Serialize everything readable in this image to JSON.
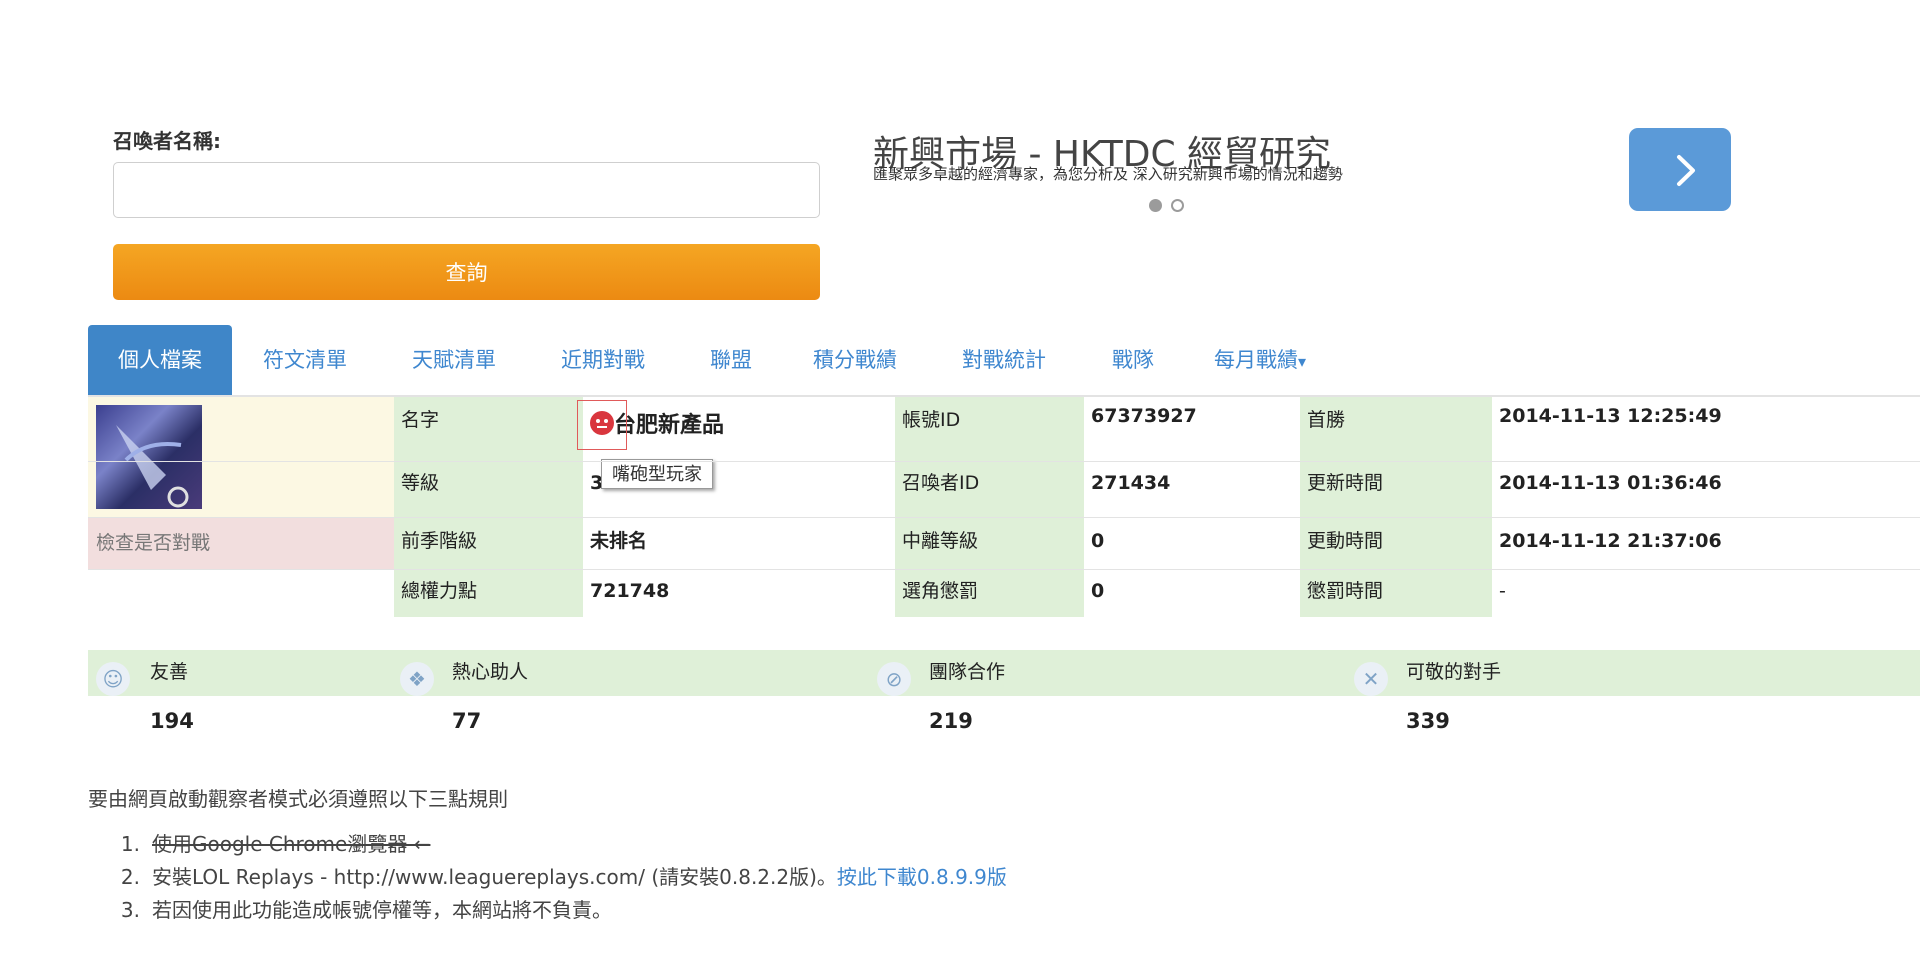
{
  "search": {
    "label": "召喚者名稱:",
    "input_value": "",
    "button_label": "查詢"
  },
  "ad": {
    "title": "新興市場 - HKTDC 經貿研究",
    "description": "匯聚眾多卓越的經濟專家，為您分析及 深入研究新興市場的情況和趨勢",
    "next_icon": "chevron-right-icon",
    "accent_color": "#5b9ad8"
  },
  "tabs": [
    {
      "label": "個人檔案",
      "active": true
    },
    {
      "label": "符文清單"
    },
    {
      "label": "天賦清單"
    },
    {
      "label": "近期對戰"
    },
    {
      "label": "聯盟"
    },
    {
      "label": "積分戰績"
    },
    {
      "label": "對戰統計"
    },
    {
      "label": "戰隊"
    },
    {
      "label": "每月戰績",
      "dropdown": true,
      "caret": "▾"
    }
  ],
  "profile": {
    "check_game": "檢查是否對戰",
    "name_label": "名字",
    "name_value": "台肥新產品",
    "name_badge_icon": "angry-face-icon",
    "tooltip": "嘴砲型玩家",
    "level_label": "等級",
    "level_value": "3",
    "prev_tier_label": "前季階級",
    "prev_tier_value": "未排名",
    "influence_label": "總權力點",
    "influence_value": "721748",
    "account_id_label": "帳號ID",
    "account_id_value": "67373927",
    "summoner_id_label": "召喚者ID",
    "summoner_id_value": "271434",
    "leaver_label": "中離等級",
    "leaver_value": "0",
    "dodge_label": "選角懲罰",
    "dodge_value": "0",
    "first_win_label": "首勝",
    "first_win_value": "2014-11-13 12:25:49",
    "updated_label": "更新時間",
    "updated_value": "2014-11-13 01:36:46",
    "modified_label": "更動時間",
    "modified_value": "2014-11-12 21:37:06",
    "penalty_label": "懲罰時間",
    "penalty_value": "-",
    "label_bg": "#dff0d8",
    "check_bg": "#f2dede"
  },
  "honors": [
    {
      "label": "友善",
      "count": "194",
      "icon": "smile-icon"
    },
    {
      "label": "熱心助人",
      "count": "77",
      "icon": "hands-icon"
    },
    {
      "label": "團隊合作",
      "count": "219",
      "icon": "team-icon"
    },
    {
      "label": "可敬的對手",
      "count": "339",
      "icon": "crossed-swords-icon"
    }
  ],
  "rules": {
    "intro": "要由網頁啟動觀察者模式必須遵照以下三點規則",
    "items": [
      {
        "num": "1.",
        "text": "使用Google Chrome瀏覽器 ←"
      },
      {
        "num": "2.",
        "text": "安裝LOL Replays - http://www.leaguereplays.com/ (請安裝0.8.2.2版)。",
        "link": "按此下載0.8.9.9版"
      },
      {
        "num": "3.",
        "text": "若因使用此功能造成帳號停權等，本網站將不負責。"
      }
    ]
  }
}
